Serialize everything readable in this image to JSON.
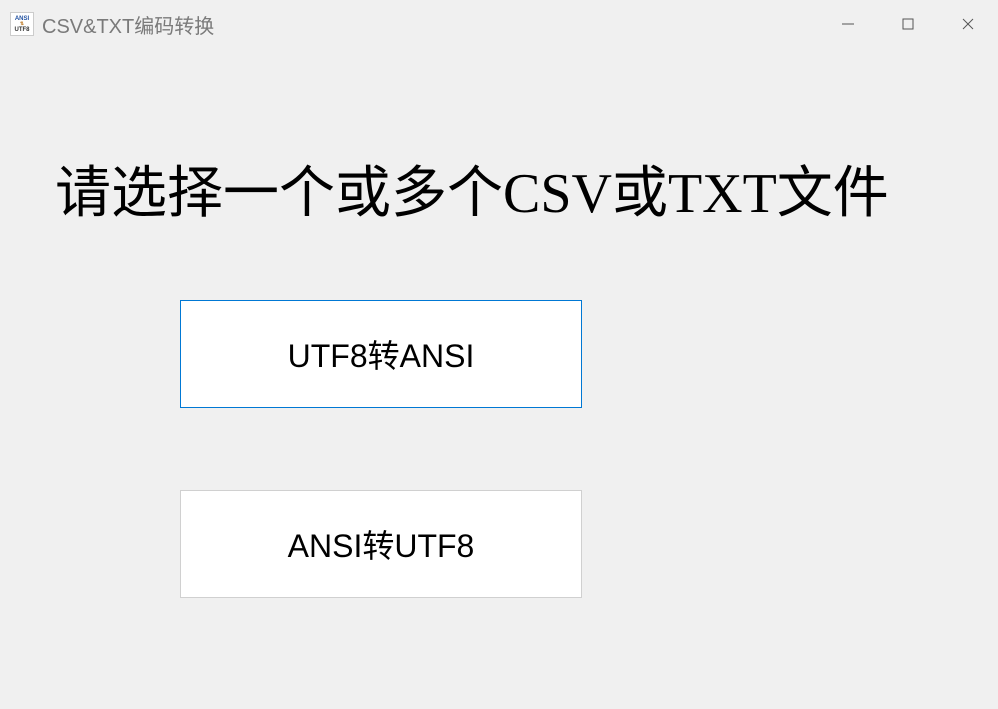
{
  "window": {
    "title": "CSV&TXT编码转换",
    "icon": {
      "line1": "ANSI",
      "line2": "⇅",
      "line3": "UTF8"
    }
  },
  "main": {
    "instruction": "请选择一个或多个CSV或TXT文件",
    "button_utf8_to_ansi": "UTF8转ANSI",
    "button_ansi_to_utf8": "ANSI转UTF8"
  }
}
